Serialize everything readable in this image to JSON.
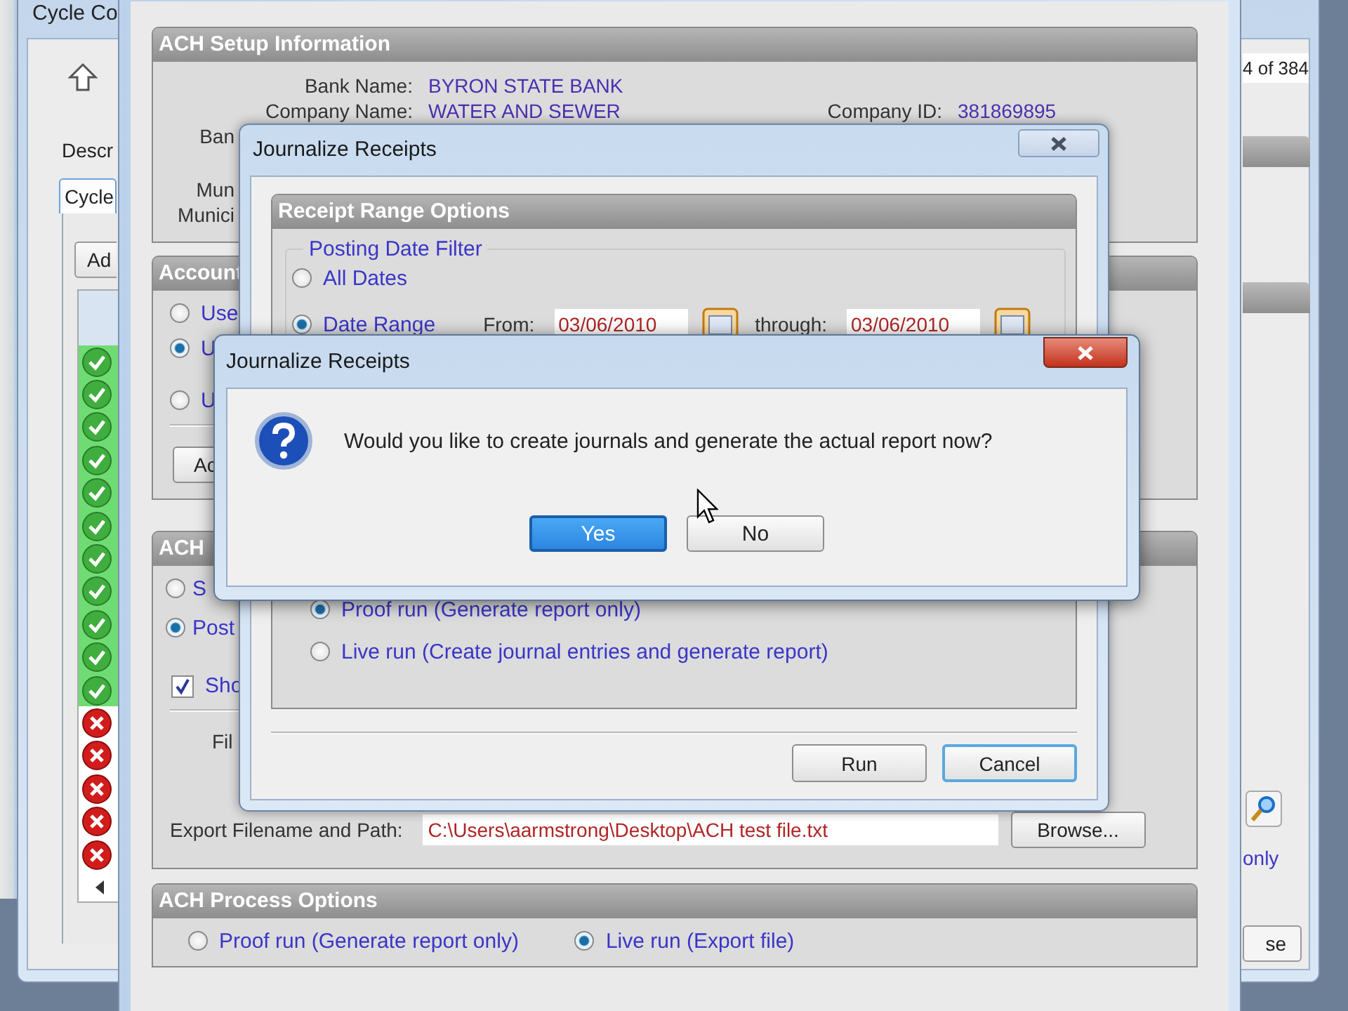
{
  "background_window": {
    "title": "Cycle Co",
    "description_label": "Descr",
    "tab": {
      "label": "Cycle",
      "selected": true
    },
    "add_button": "Ad",
    "record_counter": "4 of 384",
    "status_rows": [
      {
        "kind": "ok"
      },
      {
        "kind": "ok"
      },
      {
        "kind": "ok"
      },
      {
        "kind": "ok"
      },
      {
        "kind": "ok"
      },
      {
        "kind": "ok"
      },
      {
        "kind": "ok"
      },
      {
        "kind": "ok"
      },
      {
        "kind": "ok"
      },
      {
        "kind": "ok"
      },
      {
        "kind": "ok"
      },
      {
        "kind": "error"
      },
      {
        "kind": "error"
      },
      {
        "kind": "error"
      },
      {
        "kind": "error"
      },
      {
        "kind": "error"
      }
    ],
    "side_text": "only",
    "side_button": "se"
  },
  "ach_window": {
    "setup": {
      "title": "ACH Setup Information",
      "bank_name": {
        "label": "Bank Name:",
        "value": "BYRON STATE BANK"
      },
      "company_name": {
        "label": "Company Name:",
        "value": "WATER AND SEWER"
      },
      "company_id": {
        "label": "Company ID:",
        "value": "381869895"
      },
      "partial_labels": [
        "Ban",
        "Mun",
        "Munici"
      ]
    },
    "account": {
      "title": "Account",
      "options": [
        {
          "label": "Use",
          "selected": false
        },
        {
          "label": "U",
          "selected": true
        },
        {
          "label": "U",
          "selected": false
        }
      ],
      "button": "Ac"
    },
    "export": {
      "title": "ACH",
      "options": [
        {
          "label": "S",
          "selected": false
        },
        {
          "label": "Post",
          "selected": true
        }
      ],
      "checkbox": {
        "label": "Sho",
        "checked": true
      },
      "file_label": "Fil",
      "path_label": "Export Filename and Path:",
      "path_value": "C:\\Users\\aarmstrong\\Desktop\\ACH test file.txt",
      "browse_button": "Browse..."
    },
    "process": {
      "title": "ACH Process Options",
      "options": [
        {
          "label": "Proof run (Generate report only)",
          "selected": false
        },
        {
          "label": "Live run (Export file)",
          "selected": true
        }
      ]
    }
  },
  "journalize_window": {
    "title": "Journalize Receipts",
    "range_panel": {
      "title": "Receipt Range Options",
      "filter": {
        "legend": "Posting Date Filter",
        "options": [
          {
            "label": "All Dates",
            "selected": false
          },
          {
            "label": "Date Range",
            "selected": true
          }
        ],
        "from_label": "From:",
        "from_value": "03/06/2010",
        "through_label": "through:",
        "through_value": "03/06/2010"
      },
      "run_options": [
        {
          "label": "Proof run (Generate report only)",
          "selected": true
        },
        {
          "label": "Live run (Create journal entries and generate report)",
          "selected": false
        }
      ]
    },
    "buttons": [
      {
        "label": "Run",
        "default": false
      },
      {
        "label": "Cancel",
        "default": true
      }
    ]
  },
  "message_box": {
    "title": "Journalize Receipts",
    "message": "Would you like to create journals and generate the actual report now?",
    "buttons": [
      {
        "label": "Yes",
        "focused": true
      },
      {
        "label": "No",
        "focused": false
      }
    ]
  }
}
